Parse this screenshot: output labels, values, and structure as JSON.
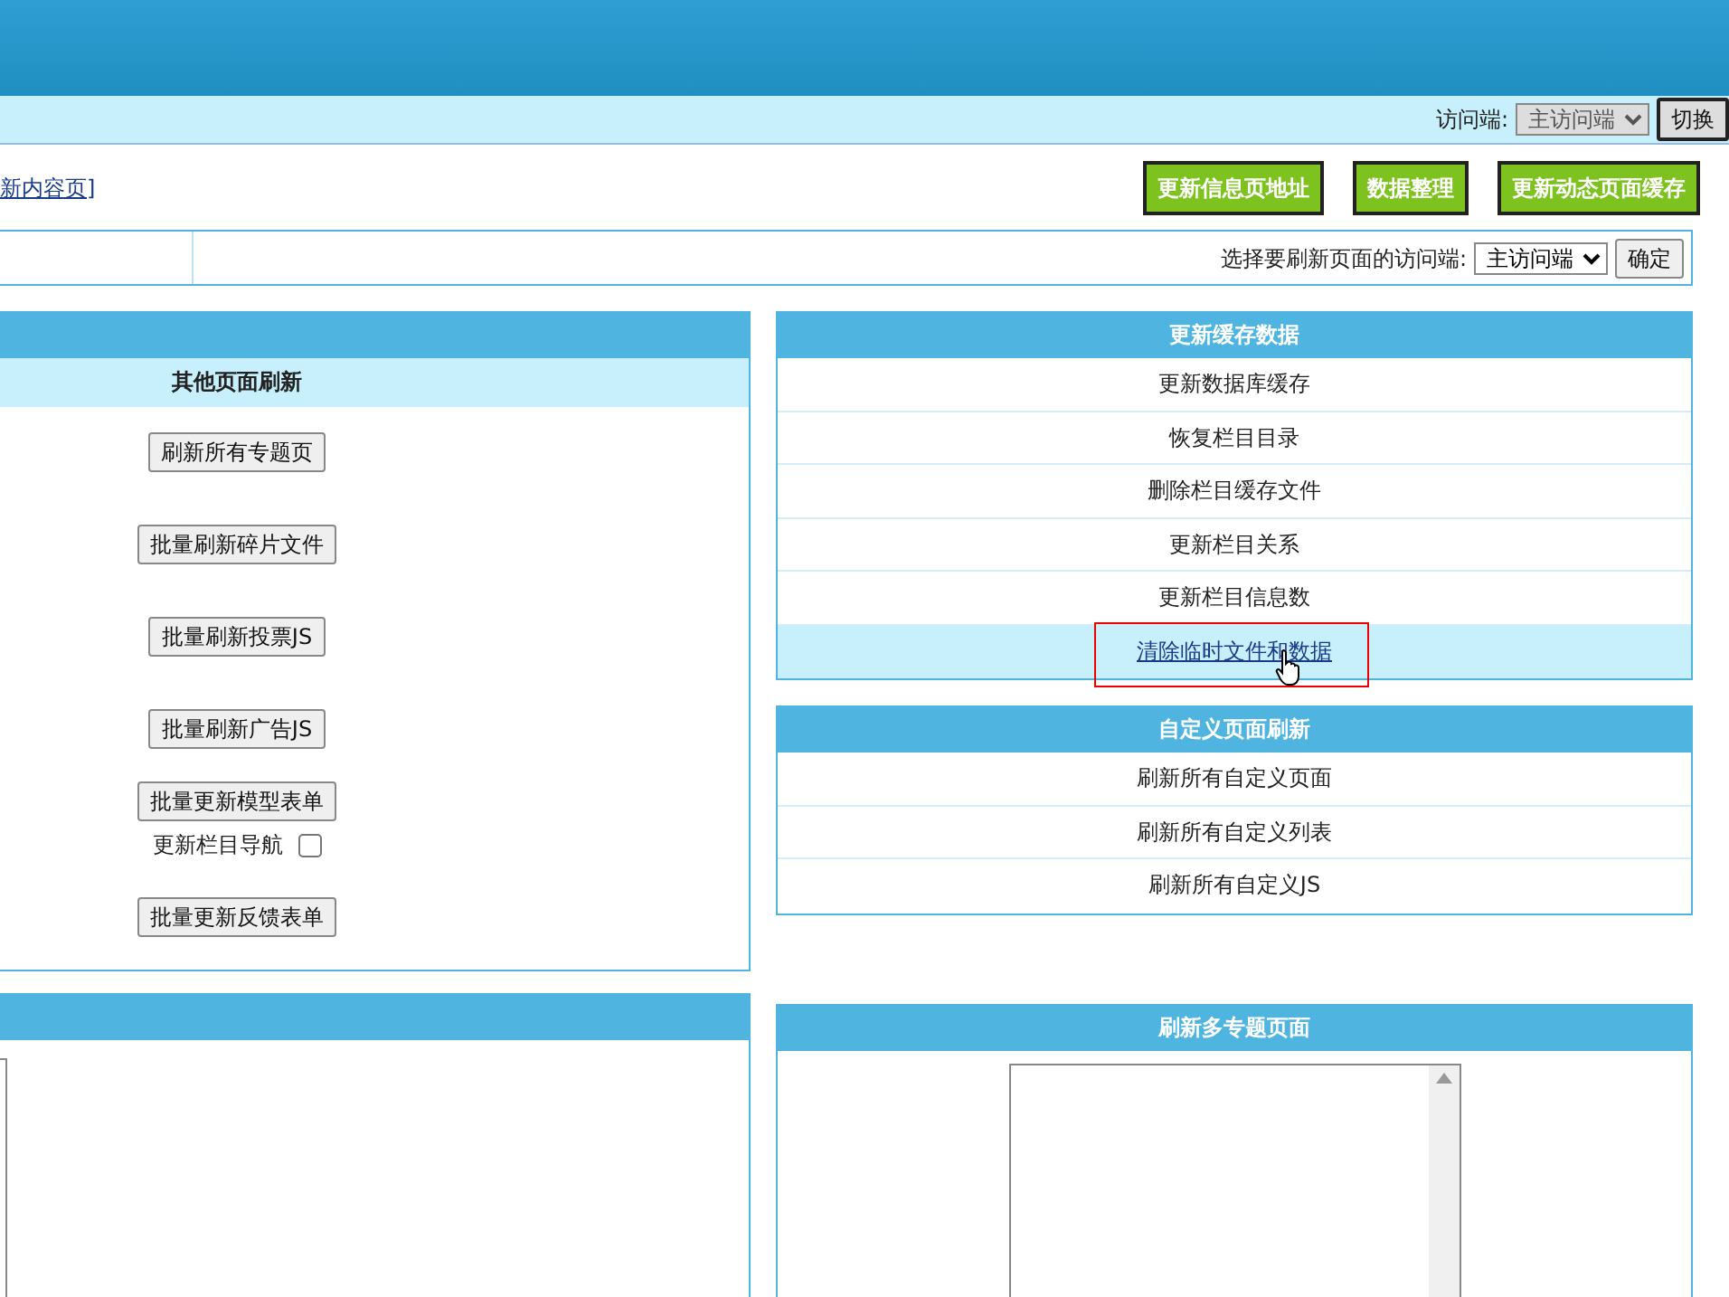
{
  "access_bar": {
    "label": "访问端:",
    "select": {
      "value": "主访问端",
      "disabled": true
    },
    "button": "切换"
  },
  "breadcrumb_tail": "新内容页]",
  "action_buttons": [
    "更新信息页地址",
    "数据整理",
    "更新动态页面缓存"
  ],
  "refresh_filter": {
    "label": "选择要刷新页面的访问端:",
    "select": {
      "value": "主访问端",
      "disabled": false
    },
    "button": "确定"
  },
  "other_pages": {
    "title": "其他页面刷新",
    "items": [
      {
        "kind": "button",
        "label": "刷新所有专题页"
      },
      {
        "kind": "button",
        "label": "批量刷新碎片文件"
      },
      {
        "kind": "button",
        "label": "批量刷新投票JS"
      },
      {
        "kind": "button",
        "label": "批量刷新广告JS"
      },
      {
        "kind": "button",
        "label": "批量更新模型表单"
      },
      {
        "kind": "checkbox",
        "label": "更新栏目导航",
        "checked": false
      },
      {
        "kind": "button",
        "label": "批量更新反馈表单"
      }
    ]
  },
  "cache_panel": {
    "title": "更新缓存数据",
    "items": [
      {
        "label": "更新数据库缓存",
        "selected": false
      },
      {
        "label": "恢复栏目目录",
        "selected": false
      },
      {
        "label": "删除栏目缓存文件",
        "selected": false
      },
      {
        "label": "更新栏目关系",
        "selected": false
      },
      {
        "label": "更新栏目信息数",
        "selected": false
      },
      {
        "label": "清除临时文件和数据",
        "selected": true
      }
    ]
  },
  "custom_panel": {
    "title": "自定义页面刷新",
    "items": [
      {
        "label": "刷新所有自定义页面",
        "selected": false
      },
      {
        "label": "刷新所有自定义列表",
        "selected": false
      },
      {
        "label": "刷新所有自定义JS",
        "selected": false
      }
    ]
  },
  "topics_panel": {
    "title": "刷新多专题页面"
  }
}
